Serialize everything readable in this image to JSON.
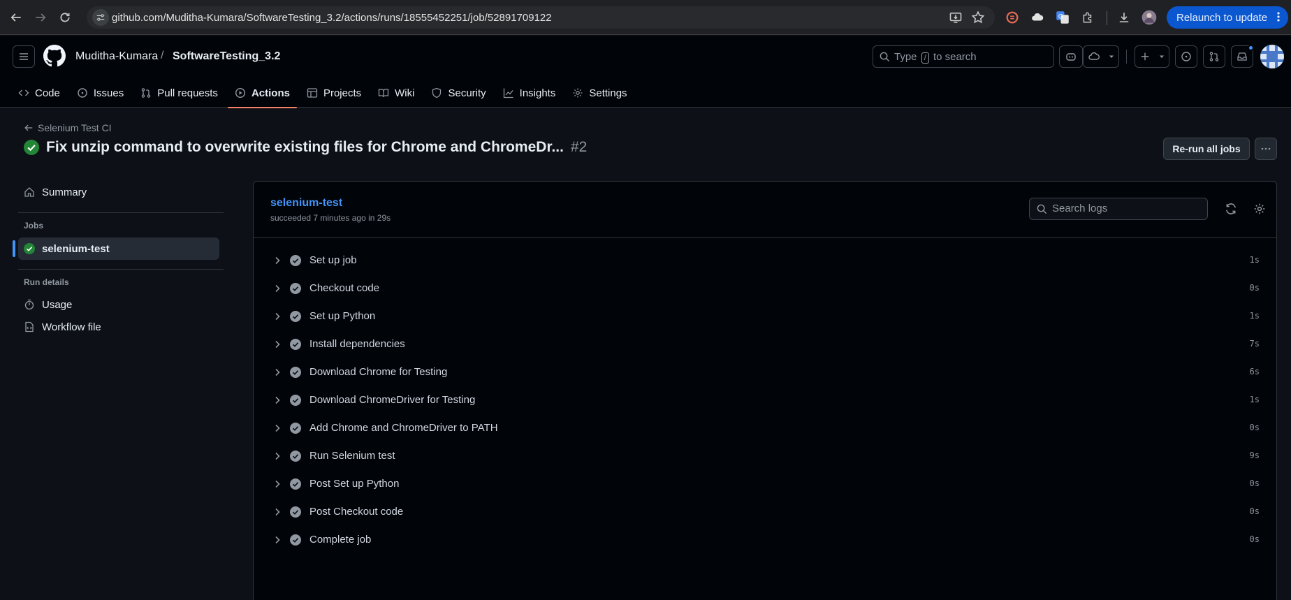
{
  "browser": {
    "url": "github.com/Muditha-Kumara/SoftwareTesting_3.2/actions/runs/18555452251/job/52891709122",
    "relaunch_label": "Relaunch to update"
  },
  "header": {
    "owner": "Muditha-Kumara",
    "separator": "/",
    "repo": "SoftwareTesting_3.2",
    "search_placeholder_before": "Type",
    "search_key": "/",
    "search_placeholder_after": "to search"
  },
  "tabs": [
    {
      "label": "Code"
    },
    {
      "label": "Issues"
    },
    {
      "label": "Pull requests"
    },
    {
      "label": "Actions"
    },
    {
      "label": "Projects"
    },
    {
      "label": "Wiki"
    },
    {
      "label": "Security"
    },
    {
      "label": "Insights"
    },
    {
      "label": "Settings"
    }
  ],
  "run": {
    "workflow_name": "Selenium Test CI",
    "title": "Fix unzip command to overwrite existing files for Chrome and ChromeDr...",
    "number": "#2",
    "rerun_label": "Re-run all jobs"
  },
  "sidebar": {
    "summary_label": "Summary",
    "jobs_heading": "Jobs",
    "job_label": "selenium-test",
    "run_details_heading": "Run details",
    "usage_label": "Usage",
    "workflow_file_label": "Workflow file"
  },
  "job": {
    "name": "selenium-test",
    "status": "succeeded 7 minutes ago in 29s",
    "search_placeholder": "Search logs",
    "steps": [
      {
        "name": "Set up job",
        "duration": "1s"
      },
      {
        "name": "Checkout code",
        "duration": "0s"
      },
      {
        "name": "Set up Python",
        "duration": "1s"
      },
      {
        "name": "Install dependencies",
        "duration": "7s"
      },
      {
        "name": "Download Chrome for Testing",
        "duration": "6s"
      },
      {
        "name": "Download ChromeDriver for Testing",
        "duration": "1s"
      },
      {
        "name": "Add Chrome and ChromeDriver to PATH",
        "duration": "0s"
      },
      {
        "name": "Run Selenium test",
        "duration": "9s"
      },
      {
        "name": "Post Set up Python",
        "duration": "0s"
      },
      {
        "name": "Post Checkout code",
        "duration": "0s"
      },
      {
        "name": "Complete job",
        "duration": "0s"
      }
    ]
  },
  "colors": {
    "success": "#238636",
    "link": "#4493f8",
    "tab_underline": "#f78166",
    "relaunch": "#0b57d0"
  }
}
